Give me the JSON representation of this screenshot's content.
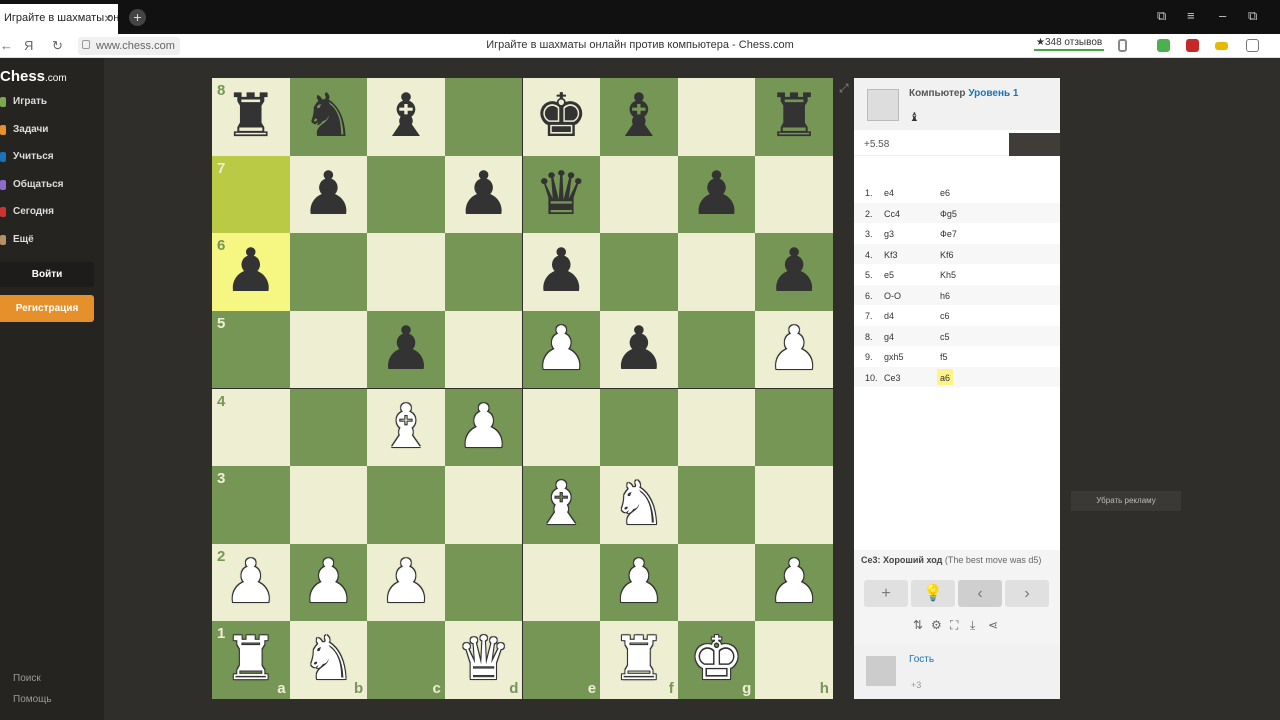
{
  "browser": {
    "tab_title": "Играйте в шахматы он",
    "tab_close": "×",
    "new_tab": "+",
    "url": "www.chess.com",
    "page_title": "Играйте в шахматы онлайн против компьютера - Chess.com",
    "reviews": "★348 отзывов",
    "yandex": "Я",
    "win_buttons": [
      "⧉",
      "≡",
      "–",
      "⧉"
    ],
    "back": "←",
    "reload": "↻"
  },
  "sidebar": {
    "logo_main": "Chess",
    "logo_suffix": ".com",
    "items": [
      {
        "label": "Играть",
        "color": "#7fa650"
      },
      {
        "label": "Задачи",
        "color": "#e6912c"
      },
      {
        "label": "Учиться",
        "color": "#1a73b8"
      },
      {
        "label": "Общаться",
        "color": "#8a6dcf"
      },
      {
        "label": "Сегодня",
        "color": "#c33"
      },
      {
        "label": "Ещё",
        "color": "#b59166"
      }
    ],
    "login": "Войти",
    "register": "Регистрация",
    "search": "Поиск",
    "help": "Помощь"
  },
  "board": {
    "ranks": [
      "8",
      "7",
      "6",
      "5",
      "4",
      "3",
      "2",
      "1"
    ],
    "files": [
      "a",
      "b",
      "c",
      "d",
      "e",
      "f",
      "g",
      "h"
    ],
    "colors": {
      "light": "#eeeed2",
      "dark": "#769656",
      "highlight_from": "#baca44",
      "highlight_to": "#f6f682"
    },
    "highlights": [
      "a7",
      "a6"
    ],
    "pieces": {
      "a8": "bR",
      "b8": "bN",
      "c8": "bB",
      "e8": "bK",
      "f8": "bB",
      "h8": "bR",
      "b7": "bP",
      "d7": "bP",
      "e7": "bQ",
      "g7": "bP",
      "a6": "bP",
      "e6": "bP",
      "h6": "bP",
      "c5": "bP",
      "e5": "wP",
      "f5": "bP",
      "h5": "wP",
      "c4": "wB",
      "d4": "wP",
      "e3": "wB",
      "f3": "wN",
      "a2": "wP",
      "b2": "wP",
      "c2": "wP",
      "f2": "wP",
      "h2": "wP",
      "a1": "wR",
      "b1": "wN",
      "d1": "wQ",
      "f1": "wR",
      "g1": "wK"
    }
  },
  "opponent": {
    "label": "Компьютер",
    "level": "Уровень 1",
    "captured": "♝"
  },
  "evaluation": "+5.58",
  "moves": [
    {
      "n": "1.",
      "w": "e4",
      "b": "e6"
    },
    {
      "n": "2.",
      "w": "Cc4",
      "b": "Фg5"
    },
    {
      "n": "3.",
      "w": "g3",
      "b": "Фe7"
    },
    {
      "n": "4.",
      "w": "Kf3",
      "b": "Kf6"
    },
    {
      "n": "5.",
      "w": "e5",
      "b": "Kh5"
    },
    {
      "n": "6.",
      "w": "O-O",
      "b": "h6"
    },
    {
      "n": "7.",
      "w": "d4",
      "b": "c6"
    },
    {
      "n": "8.",
      "w": "g4",
      "b": "c5"
    },
    {
      "n": "9.",
      "w": "gxh5",
      "b": "f5"
    },
    {
      "n": "10.",
      "w": "Ce3",
      "b": "a6"
    }
  ],
  "feedback": {
    "move": "Ce3: Хороший ход",
    "note": " (The best move was d5)"
  },
  "controls": {
    "new_game": "+",
    "hint": "💡",
    "prev": "‹",
    "next": "›",
    "tools": [
      "⇅",
      "⚙",
      "⛶",
      "⤓",
      "⋖"
    ]
  },
  "guest": {
    "name": "Гость",
    "score": "+3"
  },
  "ad": {
    "remove": "Убрать рекламу"
  }
}
